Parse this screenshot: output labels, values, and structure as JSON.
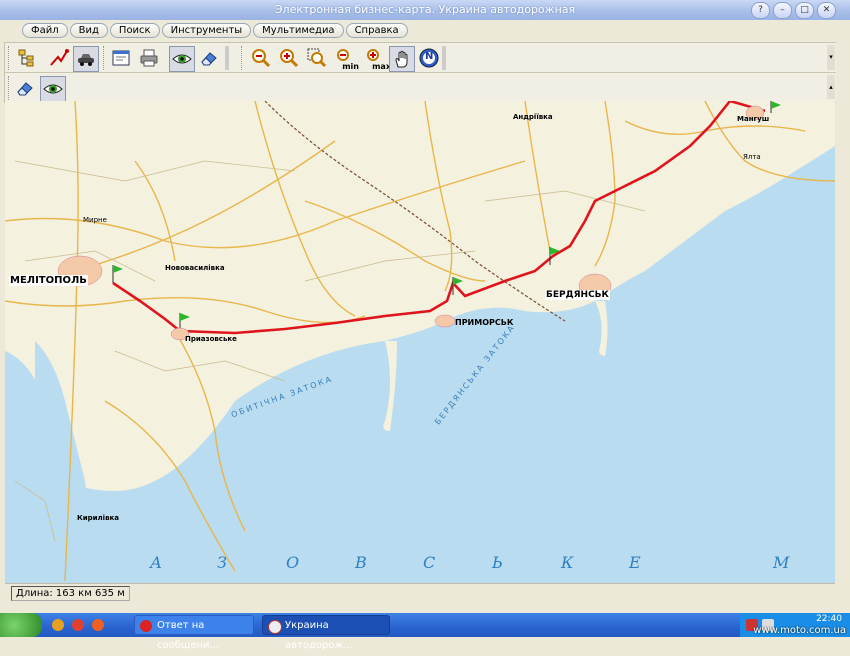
{
  "window": {
    "title": "Электронная бизнес-карта. Украина автодорожная"
  },
  "menu": [
    "Файл",
    "Вид",
    "Поиск",
    "Инструменты",
    "Мультимедиа",
    "Справка"
  ],
  "toolbar1": [
    {
      "name": "layers-tree-button",
      "icon": "layers-tree-icon"
    },
    {
      "name": "route-tool-button",
      "icon": "route-icon"
    },
    {
      "name": "car-route-button",
      "icon": "car-icon",
      "pressed": true
    },
    {
      "name": "window-button",
      "icon": "window-icon"
    },
    {
      "name": "print-button",
      "icon": "printer-icon"
    },
    {
      "name": "view-button",
      "icon": "eye-icon",
      "pressed": true
    },
    {
      "name": "eraser-button",
      "icon": "eraser-icon"
    },
    {
      "name": "zoom-out-button",
      "icon": "zoom-out-icon"
    },
    {
      "name": "zoom-in-button",
      "icon": "zoom-in-icon"
    },
    {
      "name": "zoom-area-button",
      "icon": "zoom-area-icon"
    },
    {
      "name": "zoom-min-button",
      "icon": "zoom-min-icon",
      "label": "min"
    },
    {
      "name": "zoom-max-button",
      "icon": "zoom-max-icon",
      "label": "max"
    },
    {
      "name": "pan-button",
      "icon": "hand-icon",
      "pressed": true
    },
    {
      "name": "north-button",
      "icon": "compass-north-icon",
      "label": "N"
    }
  ],
  "toolbar2": [
    {
      "name": "clear-route-button",
      "icon": "eraser-icon"
    },
    {
      "name": "show-route-button",
      "icon": "eye-icon",
      "pressed": true
    }
  ],
  "map": {
    "cities": {
      "melitopol": "МЕЛІТОПОЛЬ",
      "berdiansk": "БЕРДЯНСЬК",
      "prymorsk": "ПРИМОРСЬК",
      "pryazovske": "Приазовське",
      "novovasylivka": "Нововасилівка",
      "andriivka": "Андріївка",
      "manhush": "Мангуш",
      "yalta": "Ялта",
      "kyrylivka": "Кирилівка",
      "myrne": "Мирне"
    },
    "sea_letters": [
      "А",
      "З",
      "О",
      "В",
      "С",
      "Ь",
      "К",
      "Е",
      "М"
    ],
    "water_labels": {
      "obytichna_bay": "ОБИТІЧНА  ЗАТОКА",
      "berdianska_bay": "БЕРДЯНСЬКА  ЗАТОКА"
    },
    "colors": {
      "land": "#f4f1de",
      "sea": "#b9dcf0",
      "route": "#e0141c",
      "road": "#e8b64b",
      "flag": "#2db52b"
    }
  },
  "status": {
    "length_label": "Длина: 163 км 635 м"
  },
  "taskbar": {
    "tasks": [
      {
        "label": "Ответ на сообщени...",
        "icon": "opera-icon"
      },
      {
        "label": "Украина автодорож...",
        "icon": "map-app-icon",
        "active": true
      }
    ],
    "clock": "22:40"
  },
  "watermark": "www.moto.com.ua"
}
